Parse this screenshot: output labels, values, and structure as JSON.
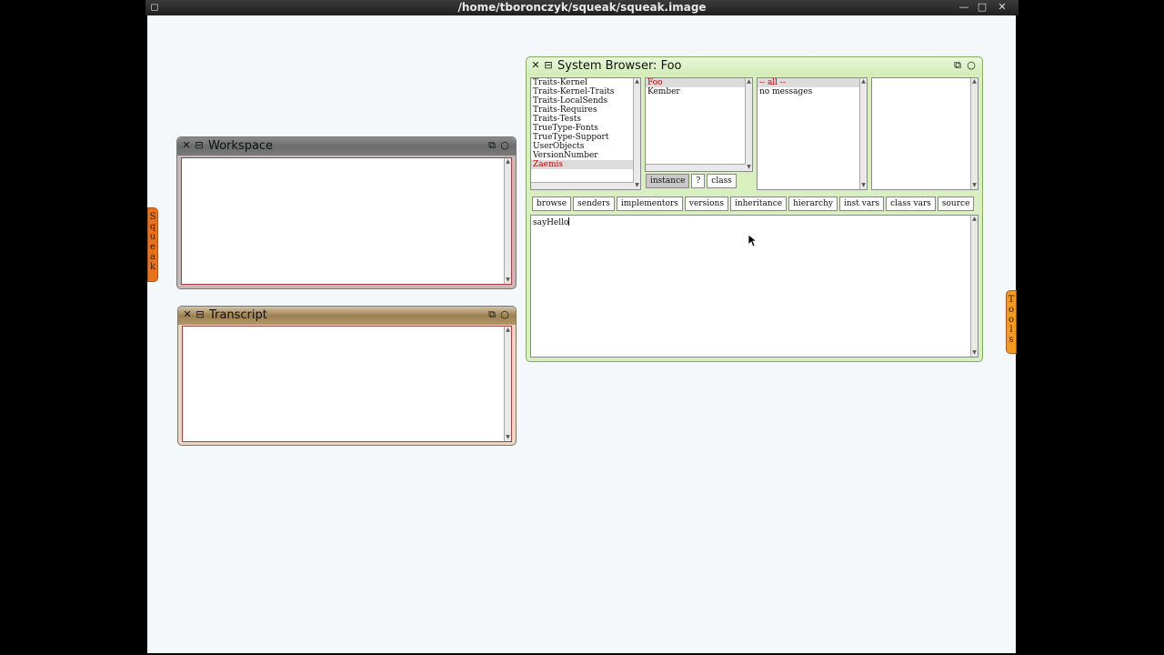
{
  "os_window": {
    "title": "/home/tboronczyk/squeak/squeak.image",
    "controls": [
      "minimize-icon",
      "maximize-icon",
      "close-icon"
    ]
  },
  "flaps": {
    "left": "Squeak",
    "right": "Tools"
  },
  "workspace": {
    "title": "Workspace",
    "content": ""
  },
  "transcript": {
    "title": "Transcript",
    "content": ""
  },
  "browser": {
    "title": "System Browser: Foo",
    "categories": [
      "Traits-Kernel",
      "Traits-Kernel-Traits",
      "Traits-LocalSends",
      "Traits-Requires",
      "Traits-Tests",
      "TrueType-Fonts",
      "TrueType-Support",
      "UserObjects",
      "VersionNumber",
      "Zaemis"
    ],
    "selected_category": "Zaemis",
    "classes": [
      "Foo",
      "Kember"
    ],
    "selected_class": "Foo",
    "protocols": [
      "-- all --",
      "no messages"
    ],
    "selected_protocol": "-- all --",
    "class_buttons": {
      "instance": "instance",
      "help": "?",
      "class": "class"
    },
    "tool_buttons": [
      "browse",
      "senders",
      "implementors",
      "versions",
      "inheritance",
      "hierarchy",
      "inst vars",
      "class vars",
      "source"
    ],
    "code": "sayHello"
  }
}
